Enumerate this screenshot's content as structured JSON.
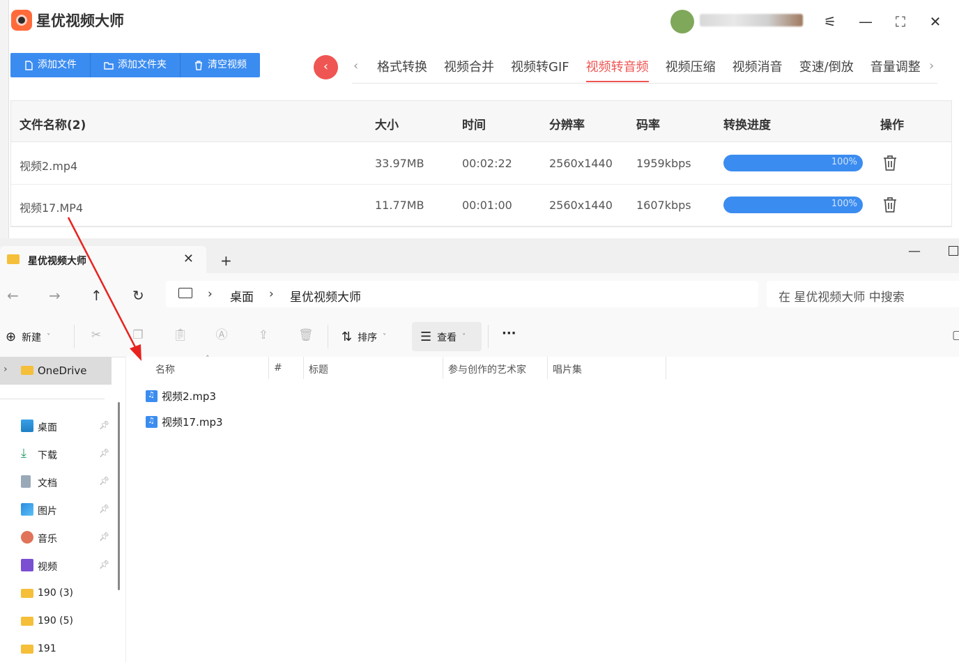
{
  "app": {
    "title": "星优视频大师",
    "user_name": "",
    "toolbar": {
      "add_file": "添加文件",
      "add_folder": "添加文件夹",
      "clear": "清空视频"
    },
    "tabs": [
      "格式转换",
      "视频合并",
      "视频转GIF",
      "视频转音频",
      "视频压缩",
      "视频消音",
      "变速/倒放",
      "音量调整"
    ],
    "active_tab": "视频转音频",
    "table": {
      "headers": {
        "name": "文件名称(2)",
        "size": "大小",
        "time": "时间",
        "resolution": "分辨率",
        "bitrate": "码率",
        "progress": "转换进度",
        "action": "操作"
      },
      "rows": [
        {
          "name": "视频2.mp4",
          "size": "33.97MB",
          "time": "00:02:22",
          "resolution": "2560x1440",
          "bitrate": "1959kbps",
          "progress": "100%"
        },
        {
          "name": "视频17.MP4",
          "size": "11.77MB",
          "time": "00:01:00",
          "resolution": "2560x1440",
          "bitrate": "1607kbps",
          "progress": "100%"
        }
      ]
    },
    "colors": {
      "accent_blue": "#3b8cf0",
      "accent_red": "#ef5552"
    }
  },
  "explorer": {
    "tab_title": "星优视频大师",
    "breadcrumb": [
      "桌面",
      "星优视频大师"
    ],
    "search_placeholder": "在 星优视频大师 中搜索",
    "commands": {
      "new": "新建",
      "sort": "排序",
      "view": "查看",
      "more": "···"
    },
    "sidebar": {
      "onedrive": "OneDrive",
      "items": [
        "桌面",
        "下载",
        "文档",
        "图片",
        "音乐",
        "视频",
        "190 (3)",
        "190 (5)",
        "191"
      ]
    },
    "columns": {
      "name": "名称",
      "number": "#",
      "title": "标题",
      "artist": "参与创作的艺术家",
      "album": "唱片集"
    },
    "files": [
      "视频2.mp3",
      "视频17.mp3"
    ]
  }
}
